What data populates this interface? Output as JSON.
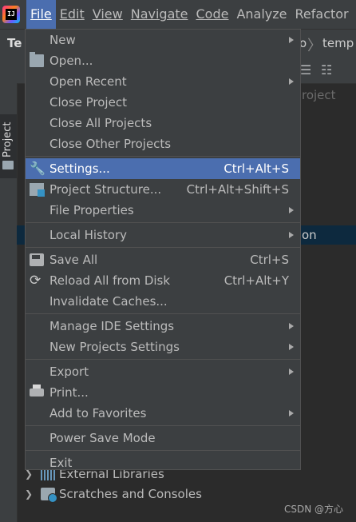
{
  "menubar": {
    "items": [
      {
        "label": "File",
        "active": true
      },
      {
        "label": "Edit"
      },
      {
        "label": "View"
      },
      {
        "label": "Navigate"
      },
      {
        "label": "Code"
      },
      {
        "label": "Analyze"
      },
      {
        "label": "Refactor"
      }
    ]
  },
  "navbar": {
    "project_fragment": "Te",
    "crumb_fragment": "o",
    "crumb": "temp"
  },
  "toolwindow": {
    "project_tab": "Project"
  },
  "panel": {
    "fragment_project": "roject",
    "fragment_selected": "on",
    "tree": [
      {
        "label": "External Libraries",
        "icon": "libraries-icon"
      },
      {
        "label": "Scratches and Consoles",
        "icon": "scratches-icon"
      }
    ]
  },
  "file_menu": {
    "new": "New",
    "open": "Open...",
    "open_recent": "Open Recent",
    "close_project": "Close Project",
    "close_all_projects": "Close All Projects",
    "close_other_projects": "Close Other Projects",
    "settings": "Settings...",
    "settings_shortcut": "Ctrl+Alt+S",
    "project_structure": "Project Structure...",
    "project_structure_shortcut": "Ctrl+Alt+Shift+S",
    "file_properties": "File Properties",
    "local_history": "Local History",
    "save_all": "Save All",
    "save_all_shortcut": "Ctrl+S",
    "reload_all": "Reload All from Disk",
    "reload_all_shortcut": "Ctrl+Alt+Y",
    "invalidate_caches": "Invalidate Caches...",
    "manage_ide_settings": "Manage IDE Settings",
    "new_projects_settings": "New Projects Settings",
    "export": "Export",
    "print": "Print...",
    "add_to_favorites": "Add to Favorites",
    "power_save_mode": "Power Save Mode",
    "exit": "Exit"
  },
  "watermark": "CSDN @方心",
  "colors": {
    "highlight": "#4b6eaf",
    "menu_bg": "#3c3f41",
    "editor_bg": "#2b2b2b",
    "selected_row": "#0d293e"
  }
}
